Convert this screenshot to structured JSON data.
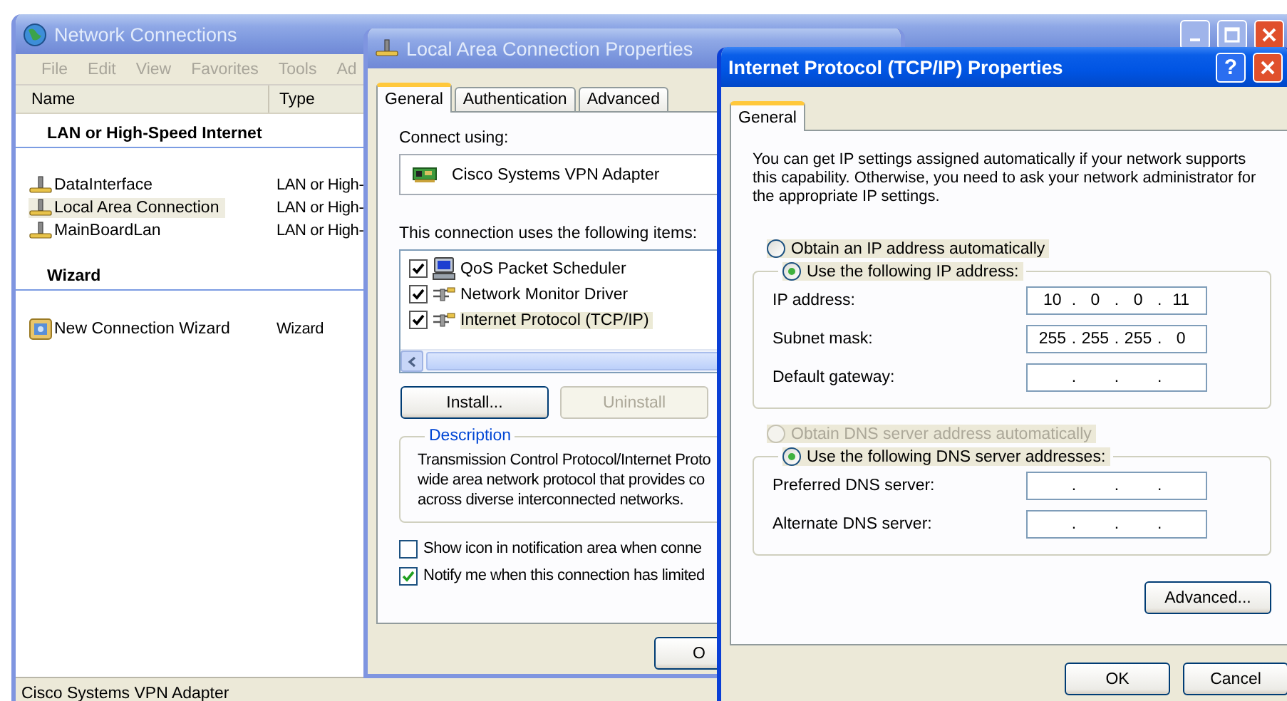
{
  "network_connections": {
    "title": "Network Connections",
    "active": false,
    "menu": [
      "File",
      "Edit",
      "View",
      "Favorites",
      "Tools",
      "Ad"
    ],
    "columns": [
      "Name",
      "Type"
    ],
    "groups": [
      {
        "title": "LAN or High-Speed Internet",
        "items": [
          {
            "name": "DataInterface",
            "type": "LAN or High-",
            "kind": "lan",
            "selected": false
          },
          {
            "name": "Local Area Connection",
            "type": "LAN or High-",
            "kind": "lan",
            "selected": true
          },
          {
            "name": "MainBoardLan",
            "type": "LAN or High-",
            "kind": "lan",
            "selected": false
          }
        ]
      },
      {
        "title": "Wizard",
        "items": [
          {
            "name": "New Connection Wizard",
            "type": "Wizard",
            "kind": "wizard",
            "selected": false
          }
        ]
      }
    ],
    "status_bar": "Cisco Systems VPN Adapter"
  },
  "lan_properties": {
    "title": "Local Area Connection Properties",
    "active": false,
    "tabs": [
      {
        "label": "General",
        "selected": true
      },
      {
        "label": "Authentication",
        "selected": false
      },
      {
        "label": "Advanced",
        "selected": false
      }
    ],
    "connect_using_label": "Connect using:",
    "adapter": "Cisco Systems VPN Adapter",
    "items_label": "This connection uses the following items:",
    "items": [
      {
        "label": "QoS Packet Scheduler",
        "kind": "scheduler",
        "checked": true,
        "selected": false
      },
      {
        "label": "Network Monitor Driver",
        "kind": "protocol",
        "checked": true,
        "selected": false
      },
      {
        "label": "Internet Protocol (TCP/IP)",
        "kind": "protocol",
        "checked": true,
        "selected": true
      }
    ],
    "buttons": [
      {
        "label": "Install...",
        "disabled": false
      },
      {
        "label": "Uninstall",
        "disabled": true
      }
    ],
    "description_title": "Description",
    "description_lines": [
      "Transmission Control Protocol/Internet Proto",
      "wide area network protocol that provides co",
      "across diverse interconnected networks."
    ],
    "options": [
      {
        "label": "Show icon in notification area when conne",
        "checked": false
      },
      {
        "label": "Notify me when this connection has limited",
        "checked": true
      }
    ],
    "ok_button": "O"
  },
  "tcpip_properties": {
    "title": "Internet Protocol (TCP/IP) Properties",
    "active": true,
    "help_button": "?",
    "tabs": [
      {
        "label": "General",
        "selected": true
      }
    ],
    "intro": "You can get IP settings assigned automatically if your network supports this capability. Otherwise, you need to ask your network administrator for the appropriate IP settings.",
    "octet_separator": ".",
    "ip_mode": [
      {
        "label": "Obtain an IP address automatically",
        "selected": false,
        "disabled": false
      },
      {
        "label": "Use the following IP address:",
        "selected": true,
        "disabled": false
      }
    ],
    "ip_fields": [
      {
        "label": "IP address:",
        "octets": [
          "10",
          "0",
          "0",
          "11"
        ]
      },
      {
        "label": "Subnet mask:",
        "octets": [
          "255",
          "255",
          "255",
          "0"
        ]
      },
      {
        "label": "Default gateway:"
      }
    ],
    "dns_mode": [
      {
        "label": "Obtain DNS server address automatically",
        "selected": false,
        "disabled": true
      },
      {
        "label": "Use the following DNS server addresses:",
        "selected": true,
        "disabled": false
      }
    ],
    "dns_fields": [
      {
        "label": "Preferred DNS server:"
      },
      {
        "label": "Alternate DNS server:"
      }
    ],
    "advanced_button": "Advanced...",
    "buttons": [
      "OK",
      "Cancel"
    ]
  }
}
